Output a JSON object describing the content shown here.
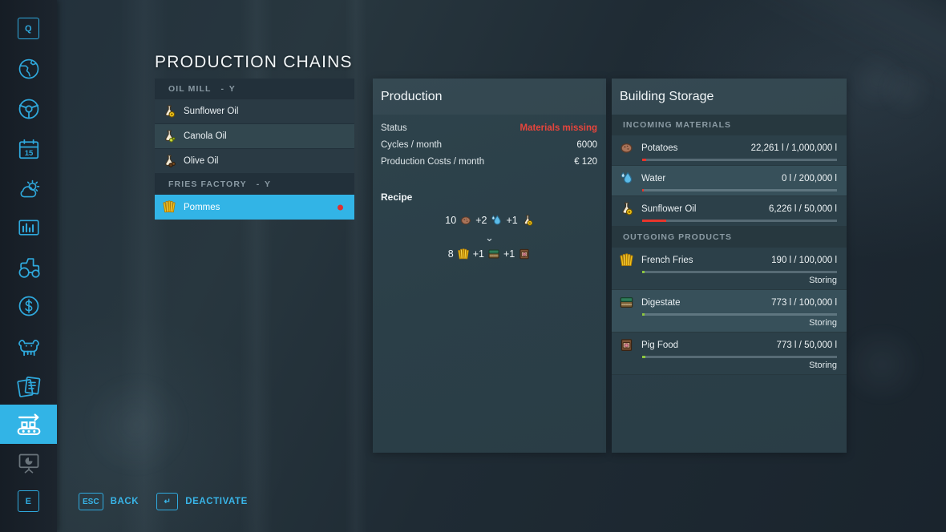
{
  "page": {
    "title": "PRODUCTION CHAINS"
  },
  "sidebar": {
    "items": [
      {
        "name": "key-q",
        "icon": "key-q-icon",
        "label": "Q",
        "active": false,
        "disabled": false
      },
      {
        "name": "map",
        "icon": "globe-map-icon",
        "label": "",
        "active": false,
        "disabled": false
      },
      {
        "name": "vehicles",
        "icon": "steering-wheel-icon",
        "label": "",
        "active": false,
        "disabled": false
      },
      {
        "name": "calendar",
        "icon": "calendar-15-icon",
        "label": "15",
        "active": false,
        "disabled": false
      },
      {
        "name": "weather",
        "icon": "weather-sun-cloud-icon",
        "label": "",
        "active": false,
        "disabled": false
      },
      {
        "name": "statistics",
        "icon": "bar-chart-icon",
        "label": "",
        "active": false,
        "disabled": false
      },
      {
        "name": "machinery",
        "icon": "tractor-icon",
        "label": "",
        "active": false,
        "disabled": false
      },
      {
        "name": "finances",
        "icon": "dollar-circle-icon",
        "label": "",
        "active": false,
        "disabled": false
      },
      {
        "name": "animals",
        "icon": "cow-icon",
        "label": "",
        "active": false,
        "disabled": false
      },
      {
        "name": "contracts",
        "icon": "documents-icon",
        "label": "",
        "active": false,
        "disabled": false
      },
      {
        "name": "production",
        "icon": "conveyor-belt-icon",
        "label": "",
        "active": true,
        "disabled": false
      },
      {
        "name": "presentation",
        "icon": "presentation-chart-icon",
        "label": "",
        "active": false,
        "disabled": true
      },
      {
        "name": "key-e",
        "icon": "key-e-icon",
        "label": "E",
        "active": false,
        "disabled": false
      }
    ]
  },
  "chain_list": {
    "groups": [
      {
        "name": "OIL MILL",
        "key": "- Y",
        "rows": [
          {
            "label": "Sunflower Oil",
            "icon": "oil-flask-sunflower-icon",
            "selected": false,
            "alt": false,
            "dot": ""
          },
          {
            "label": "Canola Oil",
            "icon": "oil-flask-canola-icon",
            "selected": false,
            "alt": true,
            "dot": ""
          },
          {
            "label": "Olive Oil",
            "icon": "oil-flask-olive-icon",
            "selected": false,
            "alt": false,
            "dot": ""
          }
        ]
      },
      {
        "name": "FRIES FACTORY",
        "key": "- Y",
        "rows": [
          {
            "label": "Pommes",
            "icon": "french-fries-icon",
            "selected": true,
            "alt": false,
            "dot": "#e03030"
          }
        ]
      }
    ]
  },
  "production": {
    "title": "Production",
    "rows": [
      {
        "label": "Status",
        "value": "Materials missing",
        "warn": true
      },
      {
        "label": "Cycles / month",
        "value": "6000",
        "warn": false
      },
      {
        "label": "Production Costs / month",
        "value": "€ 120",
        "warn": false
      }
    ],
    "recipe_title": "Recipe",
    "recipe": {
      "inputs": [
        {
          "amount": "10",
          "icon": "potato-icon",
          "name": "Potatoes"
        },
        {
          "amount": "+2",
          "icon": "water-drop-icon",
          "name": "Water"
        },
        {
          "amount": "+1",
          "icon": "oil-flask-sunflower-icon",
          "name": "Sunflower Oil"
        }
      ],
      "arrow": "⌄",
      "outputs": [
        {
          "amount": "8",
          "icon": "french-fries-icon",
          "name": "French Fries"
        },
        {
          "amount": "+1",
          "icon": "digestate-icon",
          "name": "Digestate"
        },
        {
          "amount": "+1",
          "icon": "pig-food-icon",
          "name": "Pig Food"
        }
      ]
    }
  },
  "storage": {
    "title": "Building Storage",
    "sections": [
      {
        "heading": "INCOMING MATERIALS",
        "rows": [
          {
            "name": "Potatoes",
            "icon": "potato-icon",
            "amount": "22,261 l / 1,000,000 l",
            "fill_pct": 2.2,
            "fill_color": "#e8352c",
            "state": "",
            "alt": false
          },
          {
            "name": "Water",
            "icon": "water-drop-icon",
            "amount": "0 l / 200,000 l",
            "fill_pct": 0.9,
            "fill_color": "#e8352c",
            "state": "",
            "alt": true
          },
          {
            "name": "Sunflower Oil",
            "icon": "oil-flask-sunflower-icon",
            "amount": "6,226 l / 50,000 l",
            "fill_pct": 12.5,
            "fill_color": "#e8352c",
            "state": "",
            "alt": false
          }
        ]
      },
      {
        "heading": "OUTGOING PRODUCTS",
        "rows": [
          {
            "name": "French Fries",
            "icon": "french-fries-icon",
            "amount": "190 l / 100,000 l",
            "fill_pct": 1.2,
            "fill_color": "#8cc63f",
            "state": "Storing",
            "alt": false
          },
          {
            "name": "Digestate",
            "icon": "digestate-icon",
            "amount": "773 l / 100,000 l",
            "fill_pct": 1.2,
            "fill_color": "#8cc63f",
            "state": "Storing",
            "alt": true
          },
          {
            "name": "Pig Food",
            "icon": "pig-food-icon",
            "amount": "773 l / 50,000 l",
            "fill_pct": 1.6,
            "fill_color": "#8cc63f",
            "state": "Storing",
            "alt": false
          }
        ]
      }
    ]
  },
  "footer": {
    "hints": [
      {
        "key": "ESC",
        "label": "BACK",
        "icon": "esc-key-icon"
      },
      {
        "key": "↵",
        "label": "DEACTIVATE",
        "icon": "enter-key-icon"
      }
    ]
  },
  "colors": {
    "accent": "#32b4e6",
    "warn": "#e8453c",
    "ok": "#8cc63f",
    "panel": "#2e434c"
  }
}
